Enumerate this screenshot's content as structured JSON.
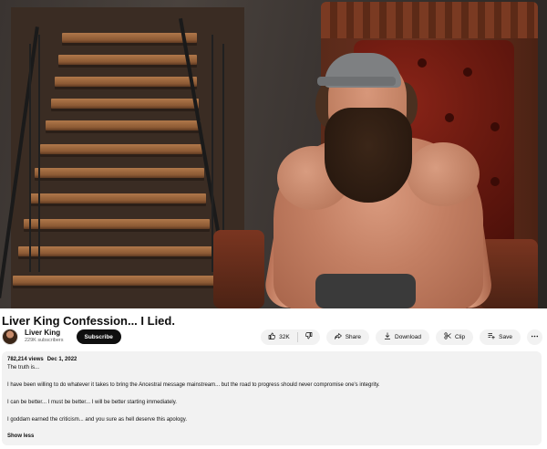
{
  "video": {
    "title": "Liver King Confession... I Lied."
  },
  "channel": {
    "name": "Liver King",
    "subscribers": "229K subscribers",
    "avatar_icon": "channel-avatar",
    "subscribe_label": "Subscribe"
  },
  "actions": {
    "like_count": "32K",
    "like_icon": "thumbs-up-icon",
    "dislike_icon": "thumbs-down-icon",
    "share_label": "Share",
    "download_label": "Download",
    "clip_label": "Clip",
    "save_label": "Save",
    "more_icon": "more-horizontal-icon"
  },
  "description": {
    "views": "782,214 views",
    "date": "Dec 1, 2022",
    "lines": [
      "The truth is...",
      "I have been willing to do whatever it takes to bring the Ancestral message mainstream... but the road to progress should never compromise one's integrity.",
      "I can be better... I must be better... I will be better starting immediately.",
      "I goddam earned the criticism... and you sure as hell deserve this apology."
    ],
    "show_less_label": "Show less"
  },
  "colors": {
    "accent": "#0f0f0f",
    "pill_bg": "#f2f2f2",
    "desc_bg": "#f2f2f2",
    "secondary_text": "#606060"
  }
}
